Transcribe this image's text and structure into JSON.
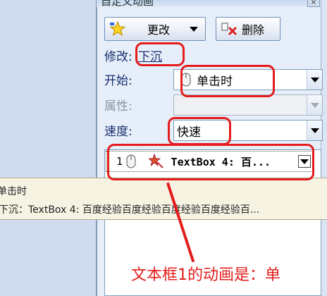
{
  "panel": {
    "title": "自定义动画",
    "change_button": "更改",
    "delete_button": "删除",
    "modify_label": "修改:",
    "modify_value": "下沉",
    "start_label": "开始:",
    "start_value": "单击时",
    "property_label": "属性:",
    "speed_label": "速度:",
    "speed_value": "快速",
    "list_item": {
      "number": "1",
      "text": "TextBox 4: 百..."
    }
  },
  "tooltip": {
    "line1": "单击时",
    "line2": "下沉：TextBox 4: 百度经验百度经验百度经验百度经验百..."
  },
  "annotation": {
    "caption": "文本框1的动画是：单",
    "color": "#e41c1c"
  }
}
